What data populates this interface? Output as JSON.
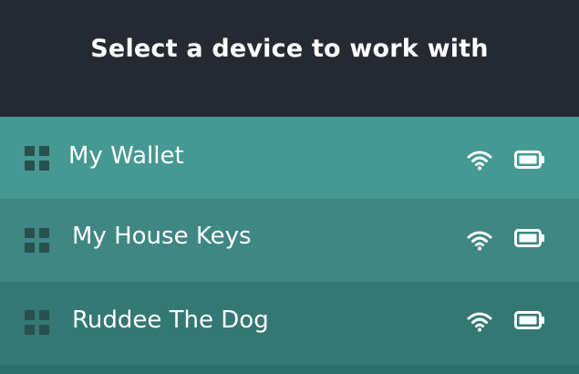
{
  "header": {
    "title": "Select a device to work with"
  },
  "devices": [
    {
      "name": "My Wallet",
      "color": "#469893"
    },
    {
      "name": "My House Keys",
      "color": "#3e8782"
    },
    {
      "name": "Ruddee The Dog",
      "color": "#347873"
    },
    {
      "name": "",
      "color": "#2c6e69"
    }
  ],
  "icons": {
    "drag_handle": "grid-icon",
    "signal": "wifi-icon",
    "battery": "battery-icon"
  },
  "colors": {
    "header_bg": "#252932",
    "icon_dark": "#28504d",
    "text": "#ffffff"
  }
}
